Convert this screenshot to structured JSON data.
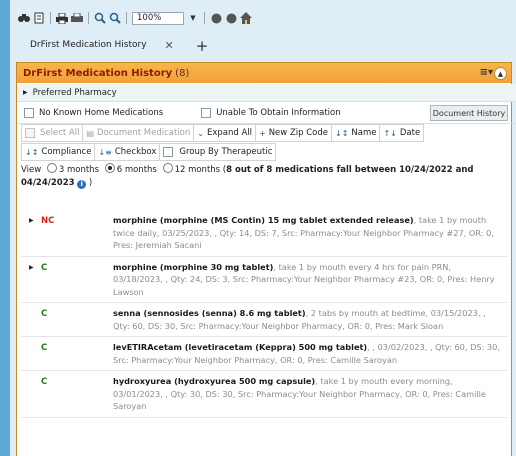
{
  "toolbar": {
    "zoom": "100%"
  },
  "tabs": [
    {
      "label": "DrFirst Medication History"
    }
  ],
  "panel": {
    "title": "DrFirst Medication History",
    "count": "(8)"
  },
  "preferred_pharmacy": {
    "label": "Preferred Pharmacy"
  },
  "options": {
    "no_known": "No Known Home Medications",
    "unable": "Unable To Obtain Information",
    "doc_history": "Document History"
  },
  "actions_row1": [
    {
      "label": "Select All",
      "disabled": true
    },
    {
      "label": "Document Medication",
      "disabled": true
    },
    {
      "label": "Expand All",
      "disabled": false
    },
    {
      "label": "New Zip Code",
      "disabled": false
    },
    {
      "label": "Name",
      "disabled": false
    },
    {
      "label": "Date",
      "disabled": false
    }
  ],
  "actions_row2": [
    {
      "label": "Compliance"
    },
    {
      "label": "Checkbox"
    },
    {
      "label": "Group By Therapeutic"
    }
  ],
  "view": {
    "prefix": "View",
    "opt3": "3 months",
    "opt6": "6 months",
    "opt12": "12 months",
    "summary": "8 out of 8 medications fall between 10/24/2022 and 04/24/2023",
    "selected": "6 months"
  },
  "medications": [
    {
      "status": "NC",
      "expandable": true,
      "name": "morphine (morphine (MS Contin) 15 mg tablet extended release)",
      "details": ", take 1 by mouth twice daily, 03/25/2023, , Qty: 14, DS: 7, Src: Pharmacy:Your Neighbor Pharmacy #27, OR: 0, Pres: Jeremiah Sacani"
    },
    {
      "status": "C",
      "expandable": true,
      "name": "morphine (morphine 30 mg tablet)",
      "details": ", take 1 by mouth every 4 hrs for pain PRN, 03/18/2023, , Qty: 24, DS: 3, Src: Pharmacy:Your Neighbor Pharmacy #23, OR: 0, Pres: Henry Lawson"
    },
    {
      "status": "C",
      "expandable": false,
      "name": "senna (sennosides (senna) 8.6 mg tablet)",
      "details": ", 2 tabs by mouth at bedtime, 03/15/2023, , Qty: 60, DS: 30, Src: Pharmacy:Your Neighbor Pharmacy, OR: 0, Pres: Mark Sloan"
    },
    {
      "status": "C",
      "expandable": false,
      "name": "levETIRAcetam (levetiracetam (Keppra) 500 mg tablet)",
      "details": ", , 03/02/2023, , Qty: 60, DS: 30, Src: Pharmacy:Your Neighbor Pharmacy, OR: 0, Pres: Camille Saroyan"
    },
    {
      "status": "C",
      "expandable": false,
      "name": "hydroxyurea (hydroxyurea 500 mg capsule)",
      "details": ", take 1 by mouth every morning, 03/01/2023, , Qty: 30, DS: 30, Src: Pharmacy:Your Neighbor Pharmacy, OR: 0, Pres: Camille Saroyan"
    }
  ]
}
